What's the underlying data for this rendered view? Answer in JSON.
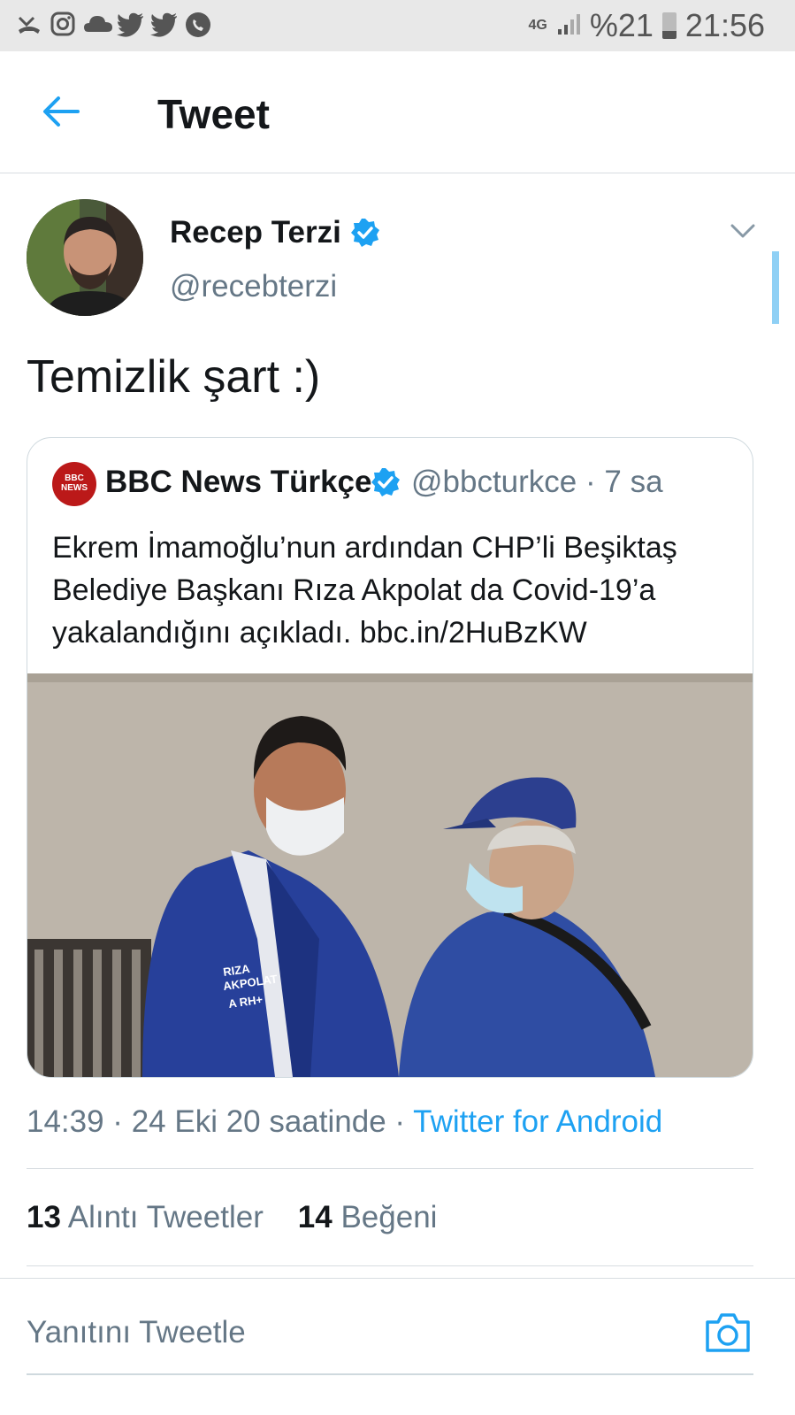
{
  "status_bar": {
    "network": "4G",
    "battery": "%21",
    "time": "21:56",
    "icons": [
      "missed-call-icon",
      "instagram-icon",
      "cloud-icon",
      "twitter-icon",
      "twitter-icon",
      "whatsapp-icon"
    ]
  },
  "header": {
    "title": "Tweet"
  },
  "tweet": {
    "author_name": "Recep Terzi",
    "author_handle": "@recebterzi",
    "text": "Temizlik şart :)",
    "time": "14:39 · 24 Eki 20 saatinde ·",
    "source": "Twitter for Android"
  },
  "quoted": {
    "logo": "BBC NEWS",
    "name": "BBC News Türkçe",
    "handle_time": "@bbcturkce · 7 sa",
    "text": "Ekrem İmamoğlu’nun ardından CHP’li Beşiktaş Belediye Başkanı Rıza Akpolat da Covid-19’a yakalandığını açıkladı. bbc.in/2HuBzKW",
    "image_jacket_text": "RIZA AKPOLAT A RH+"
  },
  "stats": {
    "quotes_count": "13",
    "quotes_label": "Alıntı Tweetler",
    "likes_count": "14",
    "likes_label": "Beğeni"
  },
  "reply": {
    "placeholder": "Yanıtını Tweetle"
  },
  "colors": {
    "accent": "#1da1f2",
    "muted": "#657786",
    "text": "#14171a"
  }
}
